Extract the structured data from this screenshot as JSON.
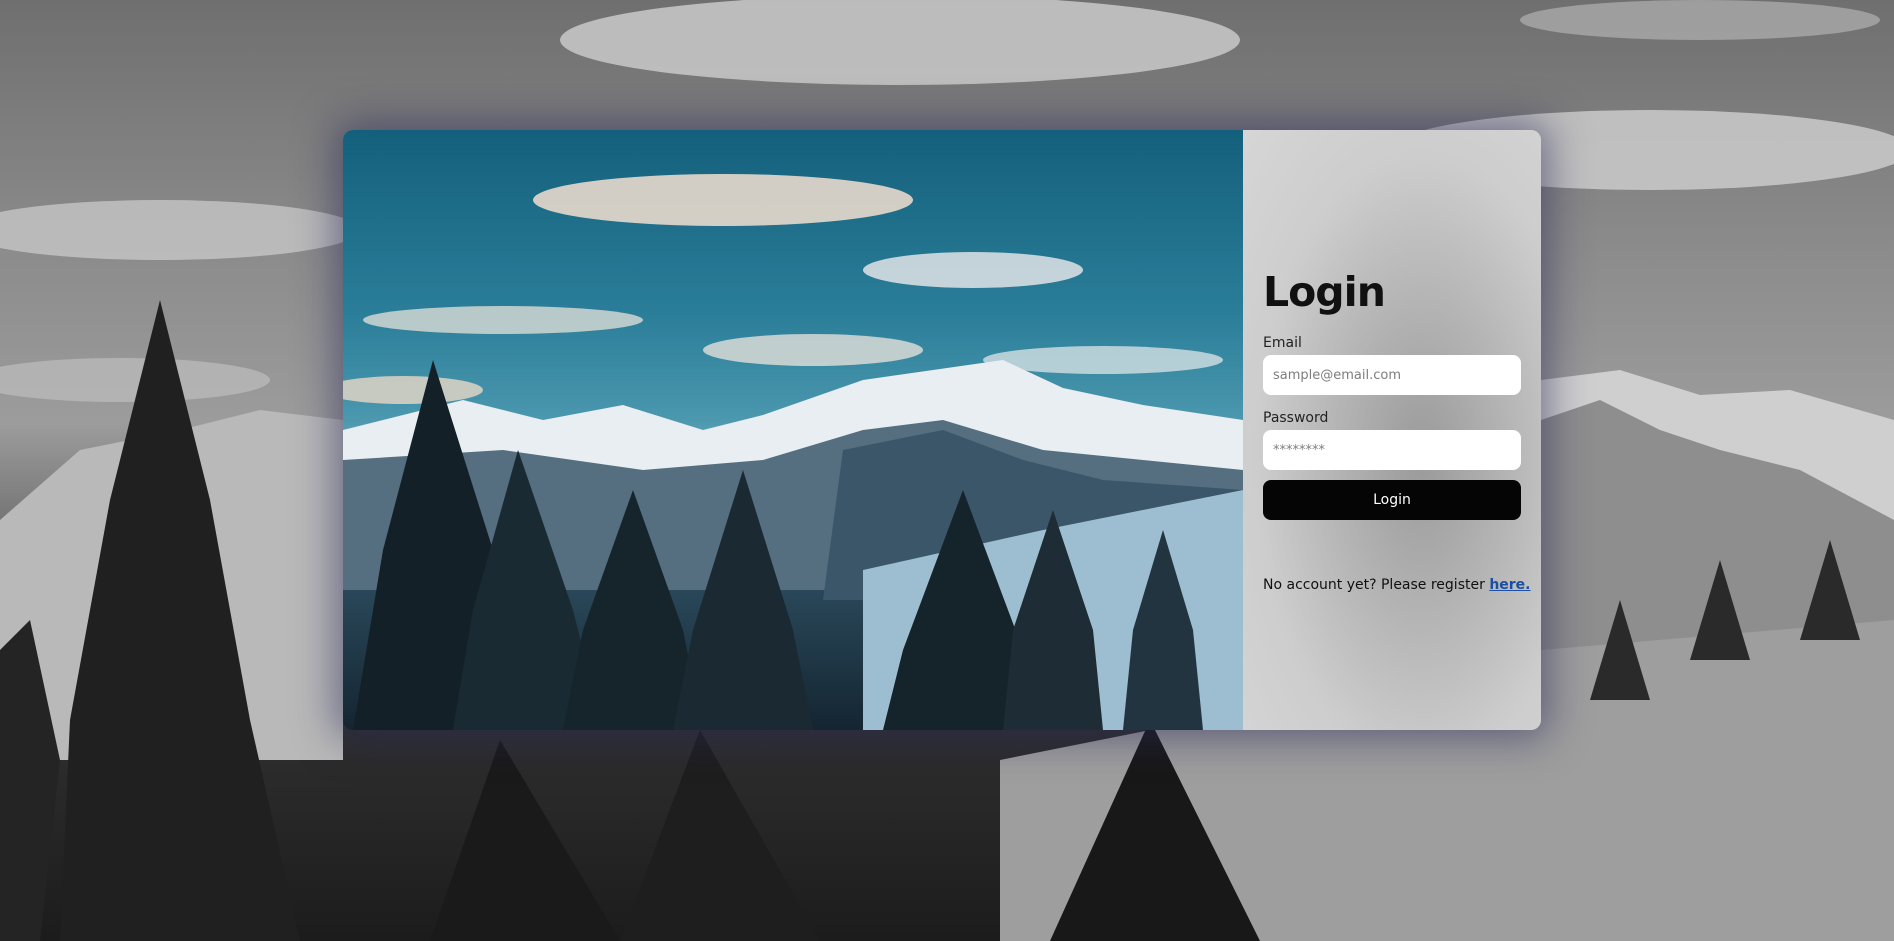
{
  "login": {
    "title": "Login",
    "email": {
      "label": "Email",
      "placeholder": "sample@email.com",
      "value": ""
    },
    "password": {
      "label": "Password",
      "placeholder": "********",
      "value": ""
    },
    "submit_label": "Login",
    "register_prompt": "No account yet? Please register ",
    "register_link_text": "here."
  },
  "colors": {
    "button_bg": "#050505",
    "link": "#1a4fa3",
    "panel_bg": "#d0d0d0"
  }
}
